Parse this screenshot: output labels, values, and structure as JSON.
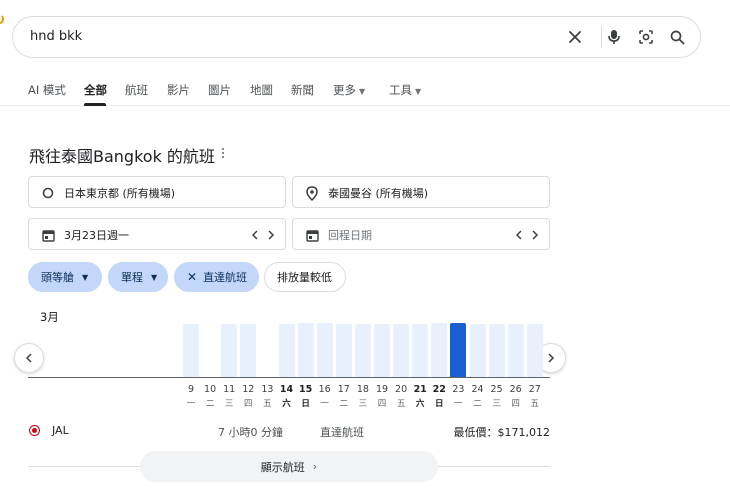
{
  "search": {
    "query": "hnd bkk"
  },
  "search_icons": [
    "close-icon",
    "microphone-icon",
    "lens-icon",
    "search-icon"
  ],
  "tabs": [
    {
      "label": "AI 模式",
      "active": false
    },
    {
      "label": "全部",
      "active": true
    },
    {
      "label": "航班",
      "active": false
    },
    {
      "label": "影片",
      "active": false
    },
    {
      "label": "圖片",
      "active": false
    },
    {
      "label": "地圖",
      "active": false
    },
    {
      "label": "新聞",
      "active": false
    },
    {
      "label": "更多",
      "active": false
    },
    {
      "label": "工具",
      "active": false
    }
  ],
  "flights": {
    "title": "飛往泰國Bangkok 的航班",
    "origin": "日本東京都 (所有機場)",
    "destination": "泰國曼谷 (所有機場)",
    "depart_date": "3月23日週一",
    "return_placeholder": "回程日期",
    "chips": {
      "cabin": "頭等艙",
      "trip_type": "單程",
      "nonstop": "直達航班",
      "emissions": "排放量較低"
    },
    "month_label": "3月",
    "days": [
      {
        "num": "9",
        "weekday": "一",
        "level": 1.0,
        "bold": false,
        "selected": false
      },
      {
        "num": "10",
        "weekday": "二",
        "level": null,
        "bold": false,
        "selected": false
      },
      {
        "num": "11",
        "weekday": "三",
        "level": 1.0,
        "bold": false,
        "selected": false
      },
      {
        "num": "12",
        "weekday": "四",
        "level": 1.0,
        "bold": false,
        "selected": false
      },
      {
        "num": "13",
        "weekday": "五",
        "level": null,
        "bold": false,
        "selected": false
      },
      {
        "num": "14",
        "weekday": "六",
        "level": 1.0,
        "bold": true,
        "selected": false
      },
      {
        "num": "15",
        "weekday": "日",
        "level": 1.02,
        "bold": true,
        "selected": false
      },
      {
        "num": "16",
        "weekday": "一",
        "level": 1.02,
        "bold": false,
        "selected": false
      },
      {
        "num": "17",
        "weekday": "二",
        "level": 1.0,
        "bold": false,
        "selected": false
      },
      {
        "num": "18",
        "weekday": "三",
        "level": 1.0,
        "bold": false,
        "selected": false
      },
      {
        "num": "19",
        "weekday": "四",
        "level": 1.0,
        "bold": false,
        "selected": false
      },
      {
        "num": "20",
        "weekday": "五",
        "level": 1.0,
        "bold": false,
        "selected": false
      },
      {
        "num": "21",
        "weekday": "六",
        "level": 1.0,
        "bold": true,
        "selected": false
      },
      {
        "num": "22",
        "weekday": "日",
        "level": 1.02,
        "bold": true,
        "selected": false
      },
      {
        "num": "23",
        "weekday": "一",
        "level": 1.02,
        "bold": false,
        "selected": true
      },
      {
        "num": "24",
        "weekday": "二",
        "level": 1.0,
        "bold": false,
        "selected": false
      },
      {
        "num": "25",
        "weekday": "三",
        "level": 1.0,
        "bold": false,
        "selected": false
      },
      {
        "num": "26",
        "weekday": "四",
        "level": 1.0,
        "bold": false,
        "selected": false
      },
      {
        "num": "27",
        "weekday": "五",
        "level": 1.0,
        "bold": false,
        "selected": false
      }
    ],
    "result": {
      "airline": "JAL",
      "duration": "7 小時0 分鐘",
      "stops": "直達航班",
      "price": "最低價：$171,012"
    },
    "show_button": "顯示航班"
  },
  "colors": {
    "chip_fill": "#c2d7fa",
    "bar_fill": "#e8f0fe",
    "bar_selected": "#1a5fd1",
    "airline_red": "#d7000f"
  }
}
